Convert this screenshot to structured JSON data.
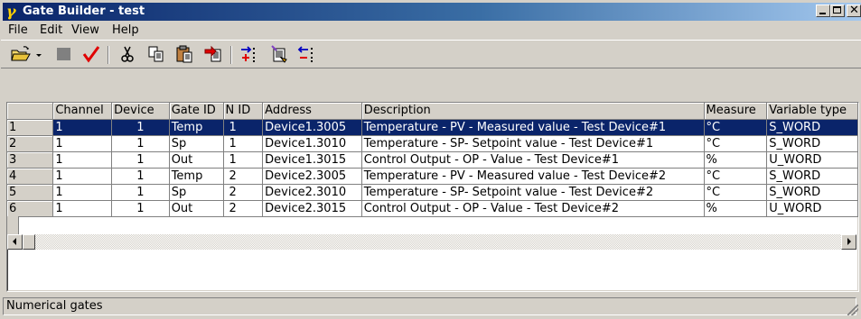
{
  "window": {
    "title": "Gate Builder - test"
  },
  "menu": {
    "items": [
      "File",
      "Edit",
      "View",
      "Help"
    ]
  },
  "toolbar": {
    "tools": [
      "open-folder-icon",
      "dropdown-arrow-icon",
      "stop-icon",
      "checkmark-icon",
      "cut-icon",
      "copy-icon",
      "paste-icon",
      "export-icon",
      "add-gate-icon",
      "gate-wizard-icon",
      "remove-gate-icon"
    ]
  },
  "grid": {
    "columns": [
      "Channel",
      "Device",
      "Gate ID",
      "N ID",
      "Address",
      "Description",
      "Measure",
      "Variable type"
    ],
    "rows": [
      {
        "num": "1",
        "channel": "1",
        "device": "1",
        "gate_id": "Temp",
        "nid": "1",
        "address": "Device1.3005",
        "description": "Temperature - PV - Measured value - Test Device#1",
        "measure": "°C",
        "vartype": "S_WORD",
        "selected": true
      },
      {
        "num": "2",
        "channel": "1",
        "device": "1",
        "gate_id": "Sp",
        "nid": "1",
        "address": "Device1.3010",
        "description": "Temperature - SP- Setpoint value - Test Device#1",
        "measure": "°C",
        "vartype": "S_WORD",
        "selected": false
      },
      {
        "num": "3",
        "channel": "1",
        "device": "1",
        "gate_id": "Out",
        "nid": "1",
        "address": "Device1.3015",
        "description": "Control Output - OP - Value - Test Device#1",
        "measure": "%",
        "vartype": "U_WORD",
        "selected": false
      },
      {
        "num": "4",
        "channel": "1",
        "device": "1",
        "gate_id": "Temp",
        "nid": "2",
        "address": "Device2.3005",
        "description": "Temperature - PV - Measured value - Test Device#2",
        "measure": "°C",
        "vartype": "S_WORD",
        "selected": false
      },
      {
        "num": "5",
        "channel": "1",
        "device": "1",
        "gate_id": "Sp",
        "nid": "2",
        "address": "Device2.3010",
        "description": "Temperature - SP- Setpoint value - Test Device#2",
        "measure": "°C",
        "vartype": "S_WORD",
        "selected": false
      },
      {
        "num": "6",
        "channel": "1",
        "device": "1",
        "gate_id": "Out",
        "nid": "2",
        "address": "Device2.3015",
        "description": "Control Output - OP - Value - Test Device#2",
        "measure": "%",
        "vartype": "U_WORD",
        "selected": false
      }
    ]
  },
  "status": {
    "text": "Numerical gates"
  },
  "colors": {
    "title_start": "#0a246a",
    "title_end": "#a6caf0",
    "selection": "#0a246a",
    "face": "#d4d0c8"
  }
}
